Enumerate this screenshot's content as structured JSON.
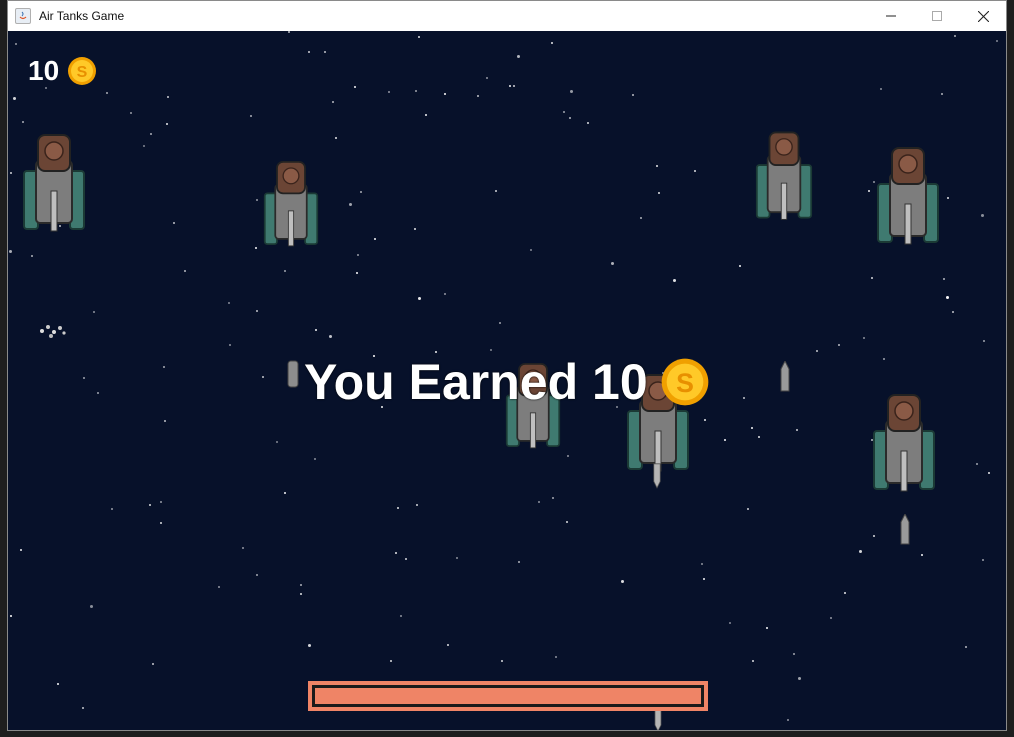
{
  "window": {
    "title": "Air Tanks Game",
    "icons": [
      "java-app-icon",
      "minimize-icon",
      "maximize-icon",
      "close-icon"
    ]
  },
  "hud": {
    "coins": "10",
    "coin_icon": "coin-icon"
  },
  "banner": {
    "text": "You Earned 10",
    "coin_icon": "coin-icon"
  },
  "player": {
    "health": 1.0,
    "health_color": "#ef8466"
  },
  "colors": {
    "background": "#07112a",
    "tank_armor": "#3f7a70",
    "tank_turret": "#6b4535",
    "coin": "#f6b800"
  }
}
